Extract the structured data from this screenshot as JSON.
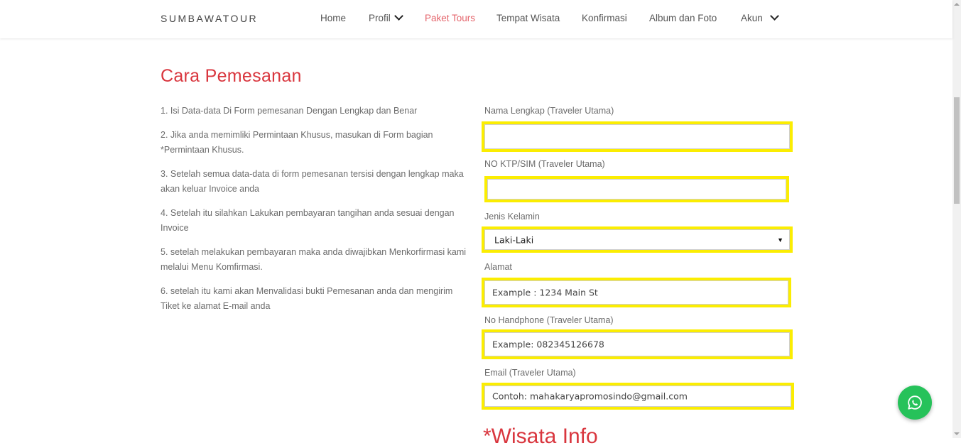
{
  "navbar": {
    "brand": "SUMBAWATOUR",
    "items": [
      {
        "label": "Home"
      },
      {
        "label": "Profil"
      },
      {
        "label": "Paket Tours"
      },
      {
        "label": "Tempat Wisata"
      },
      {
        "label": "Konfirmasi"
      },
      {
        "label": "Album dan Foto"
      },
      {
        "label": "Akun"
      }
    ],
    "active_item": "Paket Tours"
  },
  "main": {
    "title": "Cara Pemesanan",
    "steps": [
      "1. Isi Data-data Di Form pemesanan Dengan Lengkap dan Benar",
      "2. Jika anda memimliki Permintaan Khusus, masukan di Form bagian *Permintaan Khusus.",
      "3. Setelah semua data-data di form pemesanan tersisi dengan lengkap maka akan keluar Invoice anda",
      "4. Setelah itu silahkan Lakukan pembayaran tangihan anda sesuai dengan Invoice",
      "5. setelah melakukan pembayaran maka anda diwajibkan Menkorfirmasi kami melalui Menu Komfirmasi.",
      "6. setelah itu kami akan Menvalidasi bukti Pemesanan anda dan mengirim Tiket ke alamat E-mail anda"
    ],
    "next_section_heading": "*Wisata Info"
  },
  "form": {
    "nama": {
      "label": "Nama Lengkap (Traveler Utama)",
      "value": "",
      "placeholder": ""
    },
    "ktp": {
      "label": "NO KTP/SIM (Traveler Utama)",
      "value": "",
      "placeholder": ""
    },
    "gender": {
      "label": "Jenis Kelamin",
      "selected": "Laki-Laki"
    },
    "alamat": {
      "label": "Alamat",
      "placeholder": "Example : 1234 Main St"
    },
    "phone": {
      "label": "No Handphone (Traveler Utama)",
      "placeholder": "Example: 082345126678"
    },
    "email": {
      "label": "Email (Traveler Utama)",
      "placeholder": "Contoh: mahakaryapromosindo@gmail.com"
    }
  },
  "colors": {
    "accent": "#d9363e",
    "nav_active": "#e4646b",
    "highlight": "#fbed02",
    "whatsapp": "#26c25a"
  },
  "icons": {
    "chevron": "chevron-down-icon",
    "whatsapp": "whatsapp-icon"
  }
}
